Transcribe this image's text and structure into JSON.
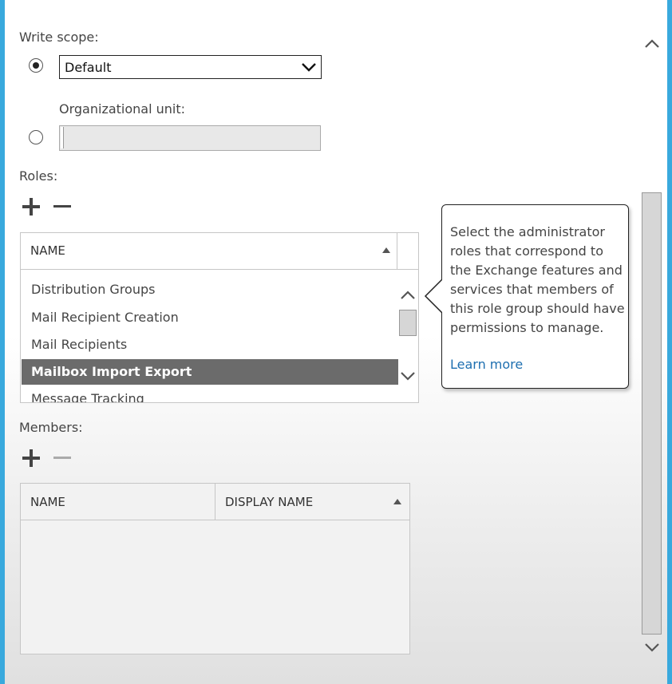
{
  "write_scope": {
    "label": "Write scope:",
    "selected_value": "Default"
  },
  "org_unit": {
    "label": "Organizational unit:",
    "value": ""
  },
  "roles": {
    "label": "Roles:",
    "column_header": "NAME",
    "items": [
      "Distribution Groups",
      "Mail Recipient Creation",
      "Mail Recipients",
      "Mailbox Import Export",
      "Message Tracking"
    ],
    "selected_item": "Mailbox Import Export"
  },
  "callout": {
    "text": "Select the administrator roles that correspond to the Exchange features and services that members of this role group should have permissions to manage.",
    "link": "Learn more"
  },
  "members": {
    "label": "Members:",
    "columns": [
      "NAME",
      "DISPLAY NAME"
    ]
  },
  "icons": [
    "radio-button",
    "chevron-down-icon",
    "plus-icon",
    "minus-icon",
    "sort-up-icon",
    "chevron-up-icon"
  ],
  "colors": {
    "window_border": "#39a9dd",
    "selected_row": "#6b6b6b",
    "link": "#1e6fb0"
  }
}
